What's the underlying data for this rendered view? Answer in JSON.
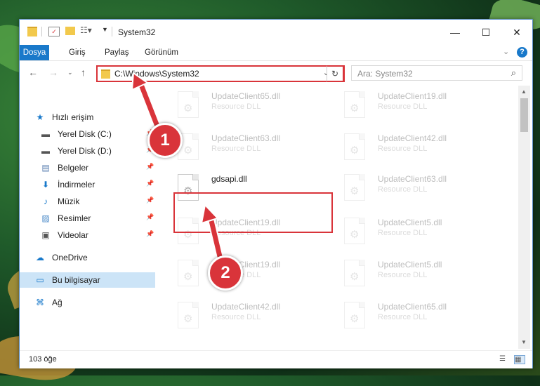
{
  "window": {
    "title": "System32"
  },
  "ribbon": {
    "tabs": [
      "Dosya",
      "Giriş",
      "Paylaş",
      "Görünüm"
    ]
  },
  "address": {
    "path": "C:\\Windows\\System32",
    "search_placeholder": "Ara: System32"
  },
  "sidebar": {
    "items": [
      {
        "label": "Hızlı erişim",
        "icon": "star-icon",
        "pinned": false
      },
      {
        "label": "Yerel Disk (C:)",
        "icon": "drive-icon",
        "pinned": true
      },
      {
        "label": "Yerel Disk (D:)",
        "icon": "drive-icon",
        "pinned": true
      },
      {
        "label": "Belgeler",
        "icon": "document-icon",
        "pinned": true
      },
      {
        "label": "İndirmeler",
        "icon": "download-icon",
        "pinned": true
      },
      {
        "label": "Müzik",
        "icon": "music-icon",
        "pinned": true
      },
      {
        "label": "Resimler",
        "icon": "picture-icon",
        "pinned": true
      },
      {
        "label": "Videolar",
        "icon": "video-icon",
        "pinned": true
      },
      {
        "label": "OneDrive",
        "icon": "cloud-icon",
        "pinned": false
      },
      {
        "label": "Bu bilgisayar",
        "icon": "computer-icon",
        "pinned": false
      },
      {
        "label": "Ağ",
        "icon": "network-icon",
        "pinned": false
      }
    ]
  },
  "files": {
    "left": [
      {
        "name": "UpdateClient65.dll",
        "type": "Resource DLL"
      },
      {
        "name": "UpdateClient63.dll",
        "type": "Resource DLL"
      },
      {
        "name": "gdsapi.dll",
        "type": ""
      },
      {
        "name": "UpdateClient19.dll",
        "type": "Resource DLL"
      },
      {
        "name": "UpdateClient19.dll",
        "type": "Resource DLL"
      },
      {
        "name": "UpdateClient42.dll",
        "type": "Resource DLL"
      }
    ],
    "right": [
      {
        "name": "UpdateClient19.dll",
        "type": "Resource DLL"
      },
      {
        "name": "UpdateClient42.dll",
        "type": "Resource DLL"
      },
      {
        "name": "UpdateClient63.dll",
        "type": "Resource DLL"
      },
      {
        "name": "UpdateClient5.dll",
        "type": "Resource DLL"
      },
      {
        "name": "UpdateClient5.dll",
        "type": "Resource DLL"
      },
      {
        "name": "UpdateClient65.dll",
        "type": "Resource DLL"
      }
    ]
  },
  "status": {
    "count": "103 öğe"
  },
  "callouts": {
    "step1": "1",
    "step2": "2"
  },
  "colors": {
    "accent": "#1979ca",
    "highlight": "#d9343a",
    "selected": "#cce4f7"
  }
}
